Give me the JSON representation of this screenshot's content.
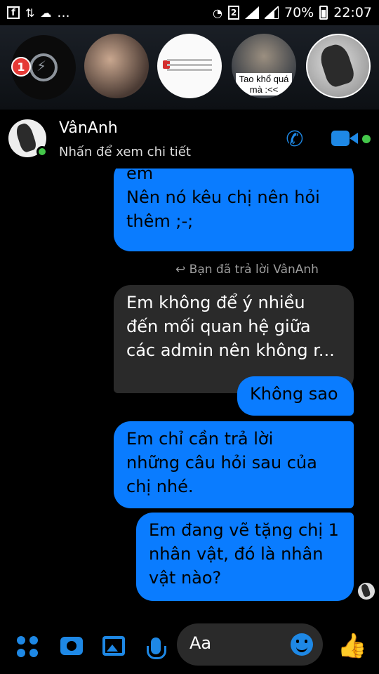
{
  "status_bar": {
    "battery_pct": "70%",
    "time": "22:07",
    "sim_slot": "2",
    "left_icons": [
      "facebook-icon",
      "data-transfer-icon",
      "cloud-icon",
      "more-dots-icon"
    ],
    "ellipsis": "..."
  },
  "chat_heads": {
    "unread_count": "1",
    "tao_caption": "Tao khổ quá mà :<<"
  },
  "header": {
    "name": "VânAnh",
    "subtitle": "Nhấn để xem chi tiết",
    "online": true
  },
  "messages": [
    {
      "side": "out",
      "lines": [
        "em",
        "Nên nó kêu chị nên hỏi",
        "thêm ;-;"
      ]
    },
    {
      "side": "in",
      "lines": [
        "Em không để ý nhiều",
        "đến mối quan hệ giữa",
        "các admin nên không r..."
      ]
    },
    {
      "side": "out",
      "lines": [
        "Không sao"
      ]
    },
    {
      "side": "out",
      "lines": [
        "Em chỉ cần trả lời",
        "những câu hỏi sau của",
        "chị nhé."
      ]
    },
    {
      "side": "out",
      "lines": [
        "Em đang vẽ tặng chị 1",
        "nhân vật, đó là nhân",
        "vật nào?"
      ]
    }
  ],
  "reply_note": "Bạn đã trả lời VânAnh",
  "composer": {
    "placeholder": "Aa"
  },
  "colors": {
    "accent": "#0a7cff",
    "online": "#44c74a",
    "badge": "#e53935"
  }
}
